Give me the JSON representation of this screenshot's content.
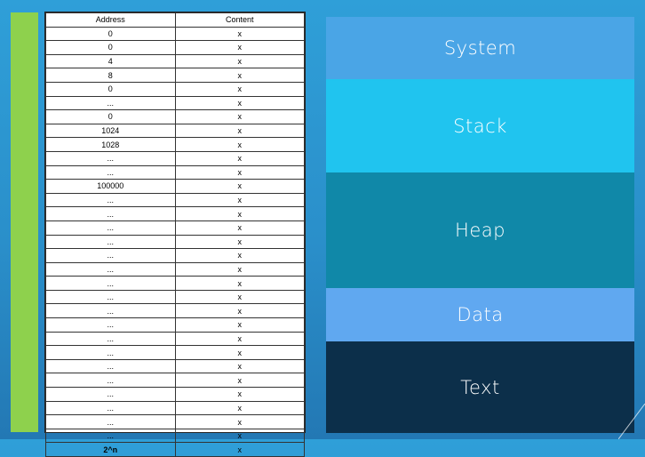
{
  "table": {
    "headers": [
      "Address",
      "Content"
    ],
    "rows": [
      {
        "address": "0",
        "content": "x"
      },
      {
        "address": "0",
        "content": "x"
      },
      {
        "address": "4",
        "content": "x"
      },
      {
        "address": "8",
        "content": "x"
      },
      {
        "address": "0",
        "content": "x"
      },
      {
        "address": "...",
        "content": "x"
      },
      {
        "address": "0",
        "content": "x"
      },
      {
        "address": "1024",
        "content": "x"
      },
      {
        "address": "1028",
        "content": "x"
      },
      {
        "address": "...",
        "content": "x"
      },
      {
        "address": "...",
        "content": "x"
      },
      {
        "address": "100000",
        "content": "x"
      },
      {
        "address": "...",
        "content": "x"
      },
      {
        "address": "...",
        "content": "x"
      },
      {
        "address": "...",
        "content": "x"
      },
      {
        "address": "...",
        "content": "x"
      },
      {
        "address": "...",
        "content": "x"
      },
      {
        "address": "...",
        "content": "x"
      },
      {
        "address": "...",
        "content": "x"
      },
      {
        "address": "...",
        "content": "x"
      },
      {
        "address": "...",
        "content": "x"
      },
      {
        "address": "...",
        "content": "x"
      },
      {
        "address": "...",
        "content": "x"
      },
      {
        "address": "...",
        "content": "x"
      },
      {
        "address": "...",
        "content": "x"
      },
      {
        "address": "...",
        "content": "x"
      },
      {
        "address": "...",
        "content": "x"
      },
      {
        "address": "...",
        "content": "x"
      },
      {
        "address": "...",
        "content": "x"
      },
      {
        "address": "...",
        "content": "x"
      },
      {
        "address": "2^n",
        "content": "x"
      }
    ]
  },
  "memory_layout": {
    "segments": [
      "System",
      "Stack",
      "Heap",
      "Data",
      "Text"
    ]
  },
  "colors": {
    "background": "#2a8fca",
    "accent_bar": "#8ed14d",
    "system": "#4aa5e6",
    "stack": "#20c4ef",
    "heap": "#1088a8",
    "data": "#60a8f0",
    "text": "#0c2f4a"
  }
}
